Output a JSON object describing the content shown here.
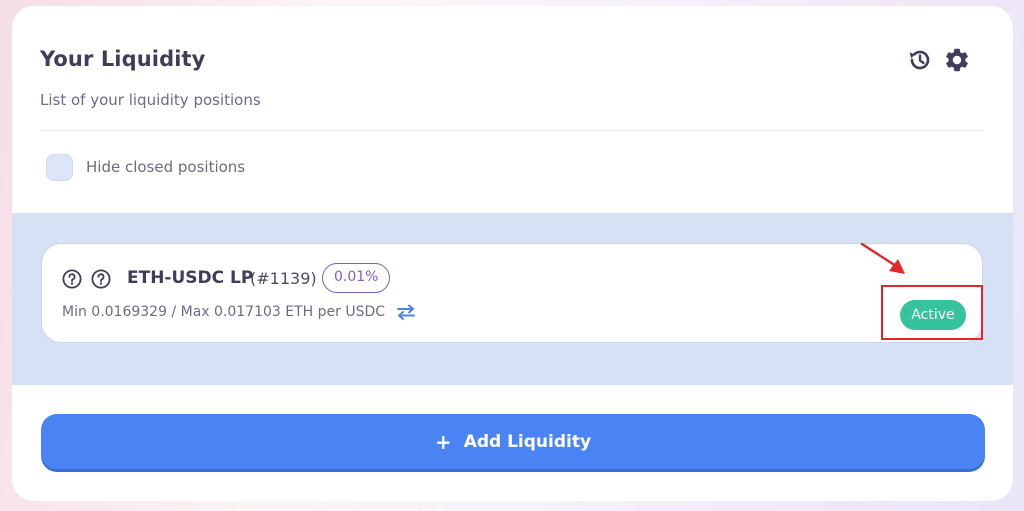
{
  "header": {
    "title": "Your Liquidity",
    "subtitle": "List of your liquidity positions",
    "icons": [
      "history-icon",
      "gear-icon"
    ]
  },
  "filter": {
    "hide_closed_label": "Hide closed positions",
    "hide_closed_checked": false
  },
  "positions": [
    {
      "pair": "ETH-USDC LP",
      "id": "(#1139)",
      "fee": "0.01%",
      "range": "Min 0.0169329 / Max 0.017103 ETH per USDC",
      "status": "Active",
      "icons": [
        "question-circle-icon",
        "question-circle-icon",
        "swap-arrows-icon"
      ]
    }
  ],
  "actions": {
    "add_liquidity_icon": "+",
    "add_liquidity_label": "Add Liquidity"
  },
  "colors": {
    "accent_blue": "#4a84f4",
    "active_green": "#34c39c",
    "fee_purple": "#7b5ed6",
    "annotation_red": "#e3262a",
    "band_bg": "#d6e1f6"
  }
}
